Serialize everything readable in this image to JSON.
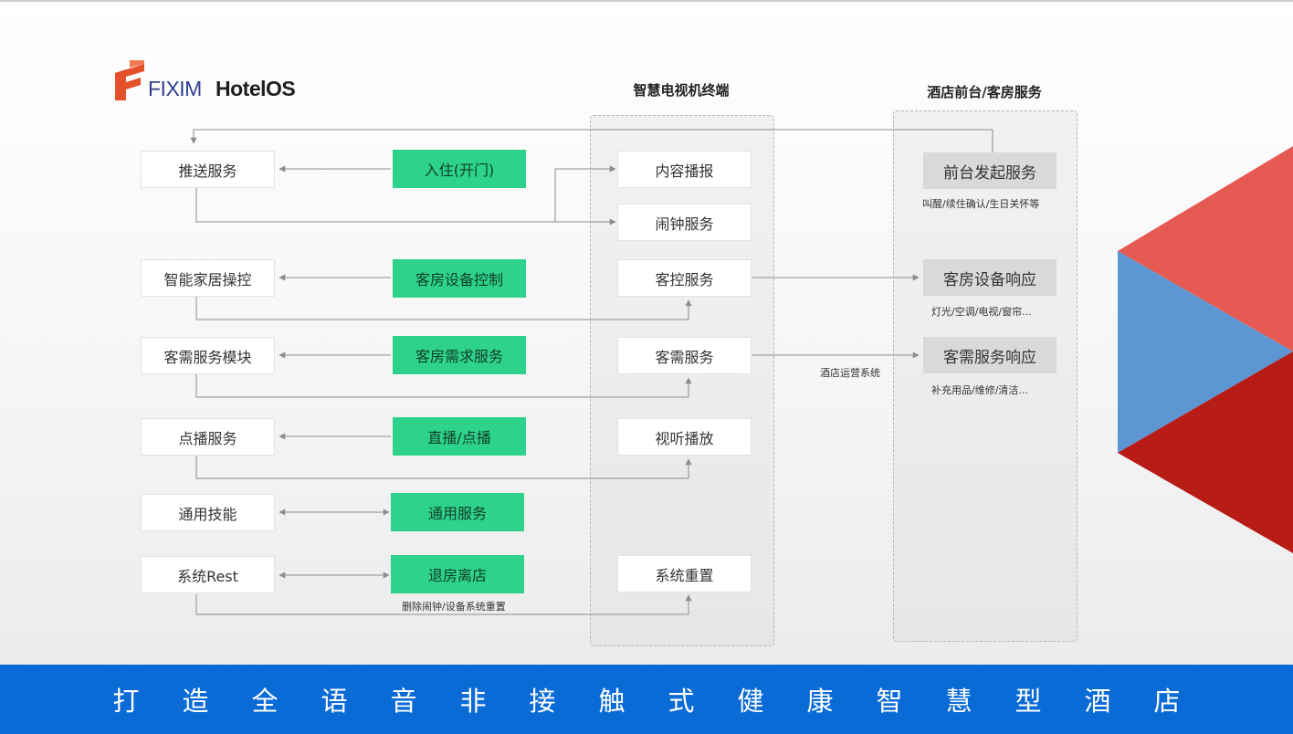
{
  "logo": {
    "brand": "FIXIM",
    "product": "HotelOS",
    "mark_color": "#e4502a"
  },
  "columns": {
    "tv_terminal": "智慧电视机终端",
    "front_desk": "酒店前台/客房服务"
  },
  "left": {
    "push": "推送服务",
    "smart_home": "智能家居操控",
    "needs_module": "客需服务模块",
    "vod": "点播服务",
    "general_skill": "通用技能",
    "system_rest": "系统Rest"
  },
  "middle": {
    "checkin": "入住(开门)",
    "room_device_control": "客房设备控制",
    "room_needs": "客房需求服务",
    "live_vod": "直播/点播",
    "general_service": "通用服务",
    "checkout": "退房离店",
    "checkout_note": "删除闹钟/设备系统重置"
  },
  "tv": {
    "content_broadcast": "内容播报",
    "alarm": "闹钟服务",
    "room_control": "客控服务",
    "guest_needs": "客需服务",
    "av_playback": "视听播放",
    "system_reset": "系统重置"
  },
  "front": {
    "desk_initiate": "前台发起服务",
    "desk_note": "叫醒/续住确认/生日关怀等",
    "device_response": "客房设备响应",
    "device_note": "灯光/空调/电视/窗帘...",
    "needs_response": "客需服务响应",
    "needs_note": "补充用品/维修/清洁...",
    "ops_system": "酒店运营系统"
  },
  "footer": {
    "slogan": "打造全语音非接触式健康智慧型酒店"
  },
  "colors": {
    "green": "#2dd38a",
    "footer_blue": "#0b6bd6",
    "deco_red": "#e55a52",
    "deco_blue": "#5c97d3",
    "deco_darkred": "#b81c17"
  }
}
